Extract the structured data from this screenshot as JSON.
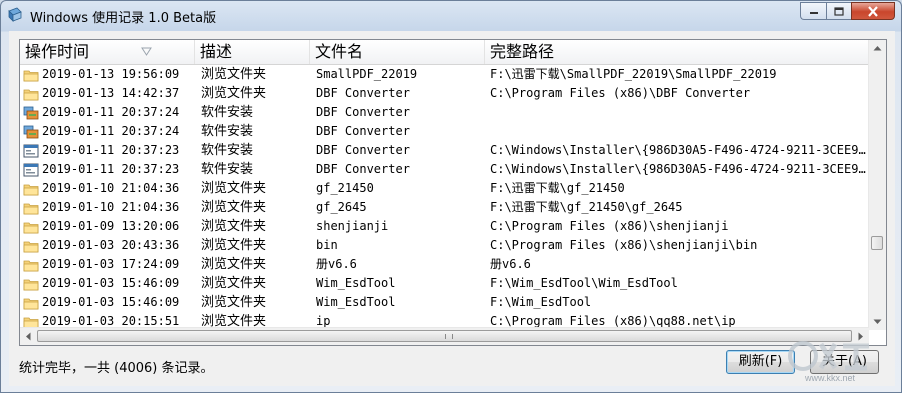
{
  "window": {
    "title": "Windows 使用记录 1.0 Beta版",
    "accent": "#c9462c"
  },
  "columns": [
    "操作时间",
    "描述",
    "文件名",
    "完整路径"
  ],
  "rows": [
    {
      "icon": "folder-icon",
      "time": "2019-01-13 19:56:09",
      "desc": "浏览文件夹",
      "name": "SmallPDF_22019",
      "path": "F:\\迅雷下载\\SmallPDF_22019\\SmallPDF_22019"
    },
    {
      "icon": "folder-icon",
      "time": "2019-01-13 14:42:37",
      "desc": "浏览文件夹",
      "name": "DBF Converter",
      "path": "C:\\Program Files (x86)\\DBF Converter"
    },
    {
      "icon": "installer-icon",
      "time": "2019-01-11 20:37:24",
      "desc": "软件安装",
      "name": "DBF Converter",
      "path": ""
    },
    {
      "icon": "installer-icon",
      "time": "2019-01-11 20:37:24",
      "desc": "软件安装",
      "name": "DBF Converter",
      "path": ""
    },
    {
      "icon": "application-icon",
      "time": "2019-01-11 20:37:23",
      "desc": "软件安装",
      "name": "DBF Converter",
      "path": "C:\\Windows\\Installer\\{986D30A5-F496-4724-9211-3CEE9..."
    },
    {
      "icon": "application-icon",
      "time": "2019-01-11 20:37:23",
      "desc": "软件安装",
      "name": "DBF Converter",
      "path": "C:\\Windows\\Installer\\{986D30A5-F496-4724-9211-3CEE9..."
    },
    {
      "icon": "folder-icon",
      "time": "2019-01-10 21:04:36",
      "desc": "浏览文件夹",
      "name": "gf_21450",
      "path": "F:\\迅雷下载\\gf_21450"
    },
    {
      "icon": "folder-icon",
      "time": "2019-01-10 21:04:36",
      "desc": "浏览文件夹",
      "name": "gf_2645",
      "path": "F:\\迅雷下载\\gf_21450\\gf_2645"
    },
    {
      "icon": "folder-icon",
      "time": "2019-01-09 13:20:06",
      "desc": "浏览文件夹",
      "name": "shenjianji",
      "path": "C:\\Program Files (x86)\\shenjianji"
    },
    {
      "icon": "folder-icon",
      "time": "2019-01-03 20:43:36",
      "desc": "浏览文件夹",
      "name": "bin",
      "path": "C:\\Program Files (x86)\\shenjianji\\bin"
    },
    {
      "icon": "folder-icon",
      "time": "2019-01-03 17:24:09",
      "desc": "浏览文件夹",
      "name": "册v6.6",
      "path": "册v6.6"
    },
    {
      "icon": "folder-icon",
      "time": "2019-01-03 15:46:09",
      "desc": "浏览文件夹",
      "name": "Wim_EsdTool",
      "path": "F:\\Wim_EsdTool\\Wim_EsdTool"
    },
    {
      "icon": "folder-icon",
      "time": "2019-01-03 15:46:09",
      "desc": "浏览文件夹",
      "name": "Wim_EsdTool",
      "path": "F:\\Wim_EsdTool"
    },
    {
      "icon": "folder-icon",
      "time": "2019-01-03 20:15:51",
      "desc": "浏览文件夹",
      "name": "ip",
      "path": "C:\\Program Files (x86)\\qq88.net\\ip"
    }
  ],
  "status": {
    "text": "统计完毕，一共 (4006) 条记录。"
  },
  "buttons": {
    "refresh": "刷新(F)",
    "about": "关于(A)"
  },
  "watermark": {
    "text": "www.kkx.net"
  }
}
